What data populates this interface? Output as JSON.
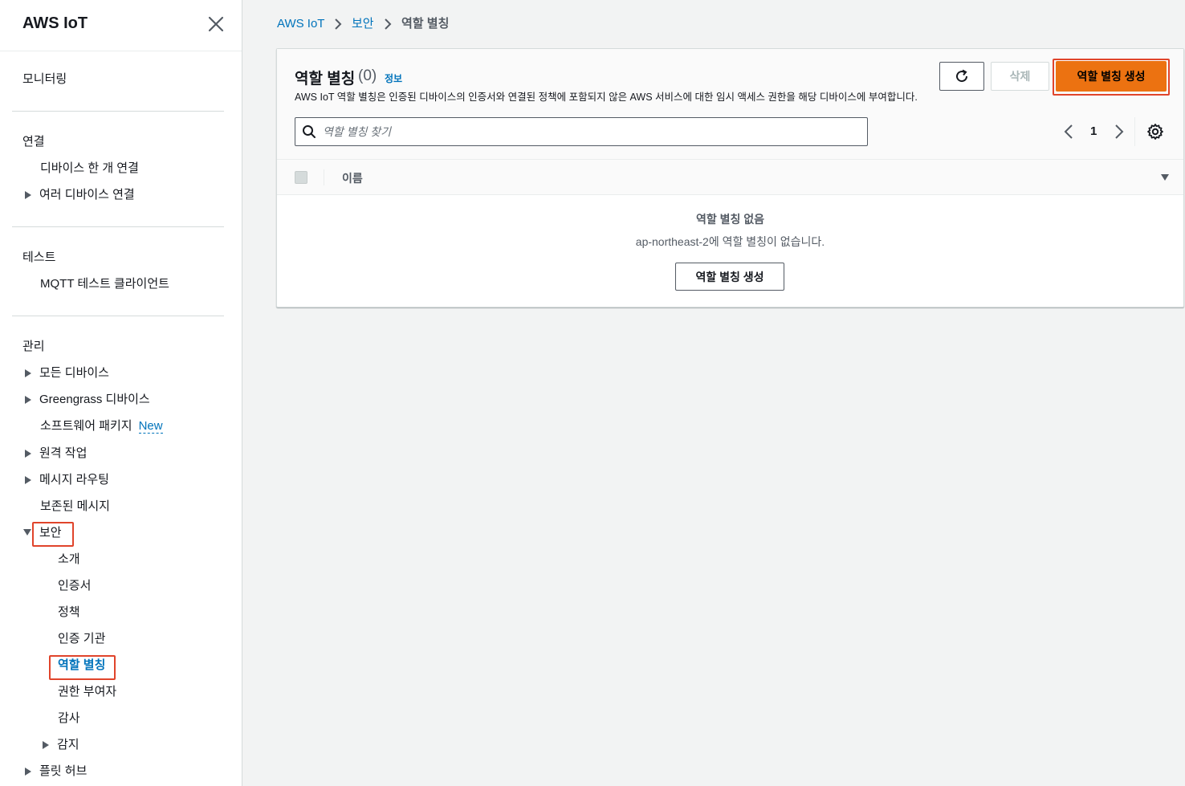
{
  "app": {
    "title": "AWS IoT"
  },
  "sidebar": {
    "monitor": "모니터링",
    "connect": {
      "label": "연결",
      "items": [
        "디바이스 한 개 연결",
        "여러 디바이스 연결"
      ]
    },
    "test": {
      "label": "테스트",
      "items": [
        "MQTT 테스트 클라이언트"
      ]
    },
    "manage": {
      "label": "관리",
      "items": [
        "모든 디바이스",
        "Greengrass 디바이스",
        "소프트웨어 패키지",
        "원격 작업",
        "메시지 라우팅",
        "보존된 메시지",
        "보안",
        "플릿 허브"
      ],
      "new_badge": "New",
      "security_sub": [
        "소개",
        "인증서",
        "정책",
        "인증 기관",
        "역할 별칭",
        "권한 부여자",
        "감사",
        "감지"
      ]
    }
  },
  "breadcrumb": [
    "AWS IoT",
    "보안",
    "역할 별칭"
  ],
  "panel": {
    "title": "역할 별칭",
    "count": "(0)",
    "info": "정보",
    "description": "AWS IoT 역할 별칭은 인증된 디바이스의 인증서와 연결된 정책에 포함되지 않은 AWS 서비스에 대한 임시 액세스 권한을 해당 디바이스에 부여합니다.",
    "delete_label": "삭제",
    "create_label": "역할 별칭 생성",
    "search_placeholder": "역할 별칭 찾기",
    "page": "1",
    "column_name": "이름",
    "empty_title": "역할 별칭 없음",
    "empty_desc": "ap-northeast-2에 역할 별칭이 없습니다.",
    "empty_button": "역할 별칭 생성"
  },
  "colors": {
    "accent": "#ec7211",
    "link": "#0073bb",
    "highlight": "#e0442b"
  },
  "icons": [
    "close-icon",
    "refresh-icon",
    "search-icon",
    "chevron-left-icon",
    "chevron-right-icon",
    "gear-icon",
    "caret-right-icon",
    "caret-down-icon",
    "sort-down-icon"
  ]
}
